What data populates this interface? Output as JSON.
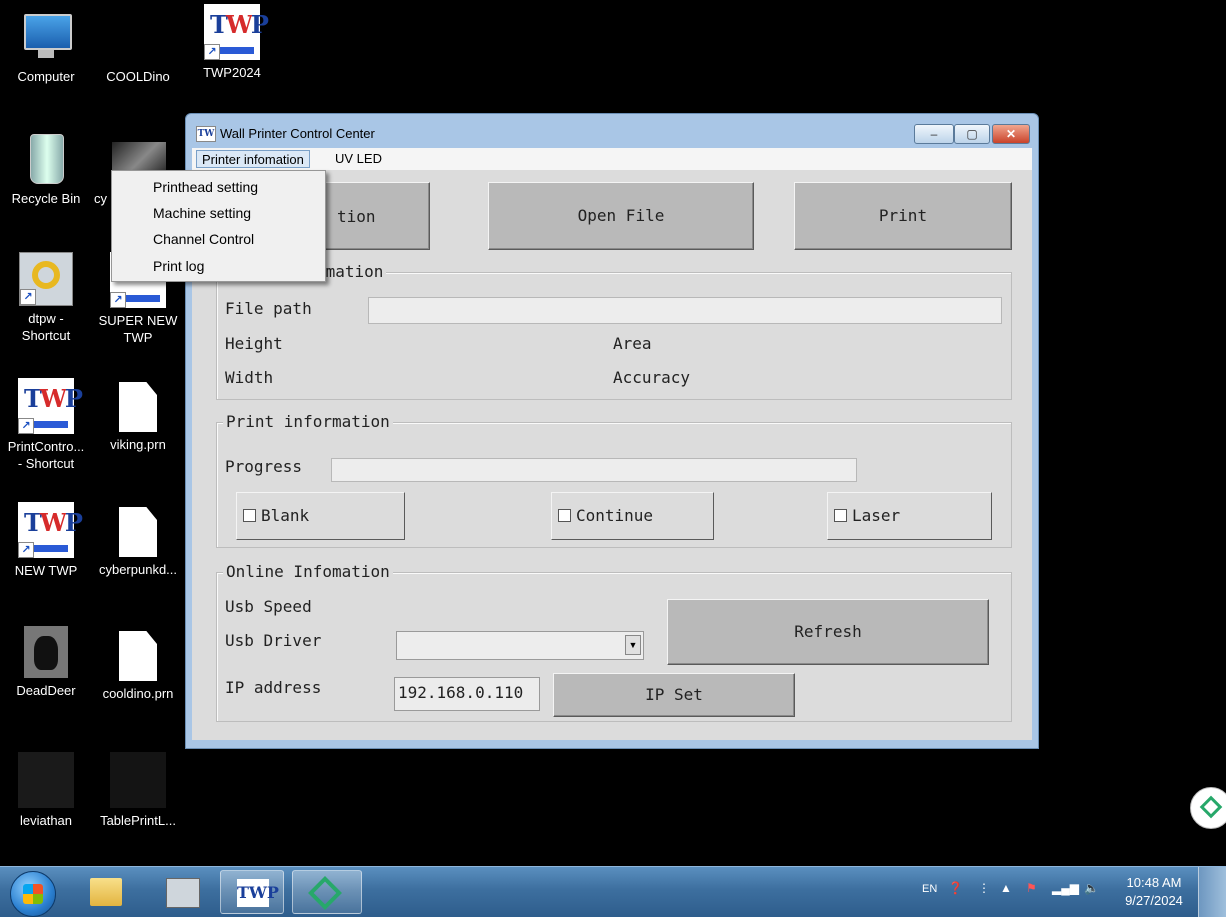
{
  "desktop": {
    "icons": [
      {
        "label": "Computer"
      },
      {
        "label": "COOLDino"
      },
      {
        "label": "TWP2024"
      },
      {
        "label": "Recycle Bin"
      },
      {
        "label": "cy"
      },
      {
        "label": "dtpw -\nShortcut"
      },
      {
        "label": "SUPER NEW\nTWP"
      },
      {
        "label": "PrintContro...\n- Shortcut"
      },
      {
        "label": "viking.prn"
      },
      {
        "label": "NEW TWP"
      },
      {
        "label": "cyberpunkd..."
      },
      {
        "label": "DeadDeer"
      },
      {
        "label": "cooldino.prn"
      },
      {
        "label": "leviathan"
      },
      {
        "label": "TablePrintL..."
      }
    ]
  },
  "window": {
    "title": "Wall Printer Control Center",
    "controls": {
      "minimize": "–",
      "maximize": "▢",
      "close": "✕"
    },
    "menu": [
      "Printer infomation",
      "UV LED"
    ],
    "dropdown": [
      "Printhead setting",
      "Machine setting",
      "Channel Control",
      "Print log"
    ],
    "buttons": {
      "first_partial": "tion",
      "open_file": "Open File",
      "print": "Print"
    },
    "file_info": {
      "title_partial": "rmation",
      "file_path_label": "File path",
      "height_label": "Height",
      "width_label": "Width",
      "area_label": "Area",
      "accuracy_label": "Accuracy"
    },
    "print_info": {
      "title": "Print information",
      "progress_label": "Progress",
      "blank": "Blank",
      "continue": "Continue",
      "laser": "Laser"
    },
    "online_info": {
      "title": "Online Infomation",
      "usb_speed_label": "Usb Speed",
      "usb_driver_label": "Usb Driver",
      "ip_label": "IP address",
      "ip_value": "192.168.0.110",
      "refresh": "Refresh",
      "ip_set": "IP Set"
    }
  },
  "taskbar": {
    "lang": "EN",
    "time": "10:48 AM",
    "date": "9/27/2024"
  }
}
